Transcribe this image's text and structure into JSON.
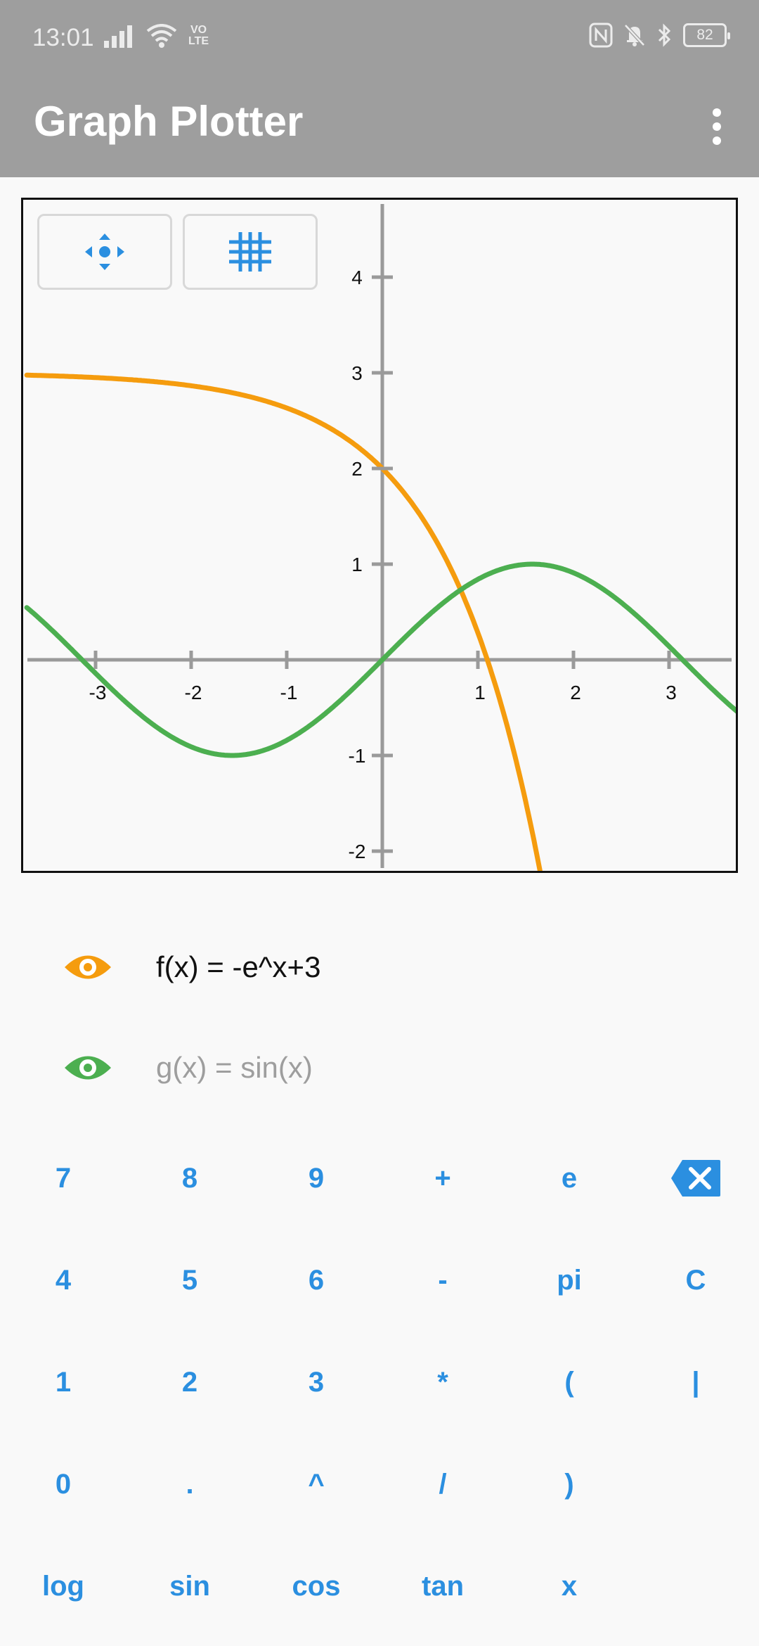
{
  "status_bar": {
    "time": "13:01",
    "volte_top": "VO",
    "volte_bottom": "LTE",
    "battery": "82"
  },
  "app_bar": {
    "title": "Graph Plotter"
  },
  "graph": {
    "x_ticks": [
      "-3",
      "-2",
      "-1",
      "1",
      "2",
      "3"
    ],
    "y_ticks": [
      "4",
      "3",
      "2",
      "1",
      "-1",
      "-2"
    ]
  },
  "chart_data": {
    "type": "line",
    "title": "",
    "xlabel": "",
    "ylabel": "",
    "xlim": [
      -3.72,
      3.72
    ],
    "ylim": [
      -2.2,
      4.8
    ],
    "x_ticks": [
      -3,
      -2,
      -1,
      1,
      2,
      3
    ],
    "y_ticks": [
      -2,
      -1,
      1,
      2,
      3,
      4
    ],
    "grid": false,
    "series": [
      {
        "name": "f(x) = -e^x+3",
        "color": "#f59c0e",
        "x": [
          -3.72,
          -3,
          -2.5,
          -2,
          -1.5,
          -1,
          -0.5,
          0,
          0.5,
          0.8,
          1.0986,
          1.3,
          1.5,
          1.64
        ],
        "y": [
          2.98,
          2.95,
          2.92,
          2.86,
          2.78,
          2.63,
          2.39,
          2,
          1.35,
          0.77,
          0,
          -0.67,
          -1.48,
          -2.16
        ]
      },
      {
        "name": "g(x) = sin(x)",
        "color": "#4caf50",
        "x": [
          -3.72,
          -3.1416,
          -2.5,
          -1.5708,
          -0.75,
          0,
          0.75,
          1.5708,
          2.5,
          3.1416,
          3.72
        ],
        "y": [
          0.55,
          0,
          -0.6,
          -1,
          -0.68,
          0,
          0.68,
          1,
          0.6,
          0,
          -0.55
        ]
      }
    ]
  },
  "functions": [
    {
      "label": "f(x) = -e^x+3",
      "color": "#f59c0e",
      "text_color": "#111111"
    },
    {
      "label": "g(x) = sin(x)",
      "color": "#4caf50",
      "text_color": "#9e9e9e"
    }
  ],
  "keypad": {
    "rows": [
      [
        "7",
        "8",
        "9",
        "+",
        "e",
        "⌫"
      ],
      [
        "4",
        "5",
        "6",
        "-",
        "pi",
        "C"
      ],
      [
        "1",
        "2",
        "3",
        "*",
        "(",
        "|"
      ],
      [
        "0",
        ".",
        "^",
        "/",
        ")",
        ""
      ],
      [
        "log",
        "sin",
        "cos",
        "tan",
        "x",
        ""
      ]
    ],
    "accent_color": "#2b8fe0"
  }
}
